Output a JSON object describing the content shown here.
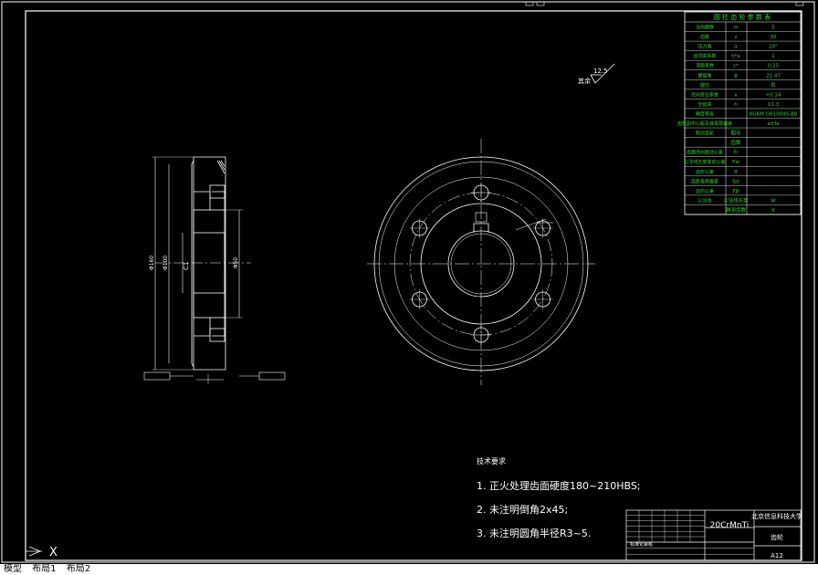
{
  "param_table": {
    "title": "圆 柱 齿 轮 参 数 表",
    "rows": [
      {
        "name": "法向模数",
        "sym": "m",
        "val": "5"
      },
      {
        "name": "齿数",
        "sym": "z",
        "val": "30"
      },
      {
        "name": "压力角",
        "sym": "α",
        "val": "20°"
      },
      {
        "name": "齿顶高系数",
        "sym": "h*a",
        "val": "1"
      },
      {
        "name": "顶隙系数",
        "sym": "c*",
        "val": "0.25"
      },
      {
        "name": "螺旋角",
        "sym": "β",
        "val": "21.47"
      },
      {
        "name": "旋向",
        "sym": "",
        "val": "右"
      },
      {
        "name": "径向变位系数",
        "sym": "x",
        "val": "+0.14"
      },
      {
        "name": "全齿高",
        "sym": "h",
        "val": "11.3"
      },
      {
        "name": "精度等级",
        "sym": "",
        "val": "8GKM GB10095-88"
      },
      {
        "name": "齿轮副中心距及其极限偏差",
        "sym": "",
        "val": "a±fa"
      },
      {
        "name": "配对齿轮",
        "sym": "图号",
        "val": ""
      },
      {
        "name": "",
        "sym": "齿数",
        "val": ""
      },
      {
        "name": "齿圈径向跳动公差",
        "sym": "Fr",
        "val": ""
      },
      {
        "name": "公法线长度变动公差",
        "sym": "Fw",
        "val": ""
      },
      {
        "name": "齿形公差",
        "sym": "ff",
        "val": ""
      },
      {
        "name": "齿距极限偏差",
        "sym": "fpt",
        "val": ""
      },
      {
        "name": "齿向公差",
        "sym": "Fβ",
        "val": ""
      },
      {
        "name": "公法线",
        "sym": "公法线长度",
        "val": "W"
      },
      {
        "name": "",
        "sym": "跨测齿数",
        "val": "K"
      }
    ]
  },
  "roughness": {
    "label": "其余",
    "value": "12.5"
  },
  "tech_req": {
    "title": "技术要求",
    "items": [
      "1. 正火处理齿面硬度180~210HBS;",
      "2. 未注明倒角2x45;",
      "3. 未注明圆角半径R3~5."
    ]
  },
  "title_block": {
    "material": "20CrMnTi",
    "company": "北京信息科技大学",
    "part_name": "齿轮",
    "drawing_no": "A12",
    "sign_label": "标准化审核"
  },
  "section_dims": {
    "outer": "Φ160",
    "hub": "Φ100",
    "bore": "Φ50",
    "callout": "C1"
  },
  "ucs_label": "X",
  "status_tabs": [
    "模型",
    "布局1",
    "布局2"
  ]
}
